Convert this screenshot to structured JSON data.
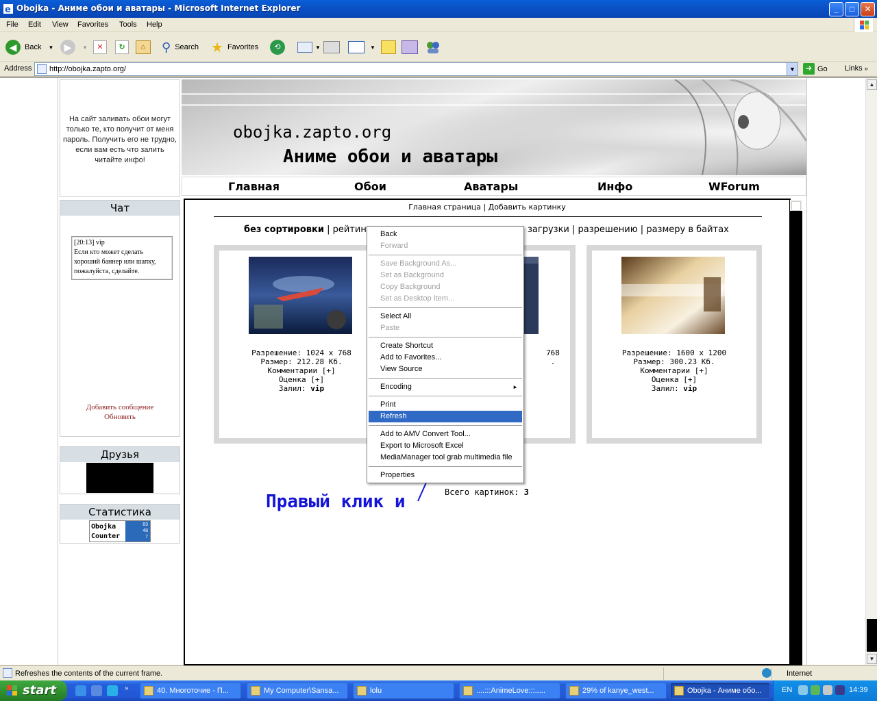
{
  "window": {
    "title": "Obojka - Аниме обои и аватары - Microsoft Internet Explorer",
    "buttons": [
      "_",
      "□",
      "✕"
    ]
  },
  "menu": [
    "File",
    "Edit",
    "View",
    "Favorites",
    "Tools",
    "Help"
  ],
  "toolbar": {
    "back": "Back",
    "search": "Search",
    "favorites": "Favorites"
  },
  "address": {
    "label": "Address",
    "url": "http://obojka.zapto.org/",
    "go": "Go",
    "links": "Links"
  },
  "sidebar": {
    "info_text": "На сайт заливать обои могут только те, кто получит от меня пароль. Получить его не трудно, если вам есть что залить читайте инфо!",
    "chat_title": "Чат",
    "chat_message": {
      "time": "[20:13] vip",
      "text": "Если кто может сделать хороший баннер или шапку, пожалуйста, сделайте."
    },
    "chat_add": "Добавить сообщение",
    "chat_refresh": "Обновить",
    "friends_title": "Друзья",
    "stats_title": "Статистика",
    "counter": {
      "label_1": "Obojka",
      "label_2": "Counter",
      "values": [
        "83",
        "48",
        "7"
      ]
    }
  },
  "banner": {
    "site": "obojka.zapto.org",
    "subtitle": "Аниме обои и аватары"
  },
  "nav": [
    "Главная",
    "Обои",
    "Аватары",
    "Инфо",
    "WForum"
  ],
  "content": {
    "breadcrumbs": "Главная страница | Добавить картинку",
    "sort": {
      "current": "без сортировки",
      "rest": " | рейтин",
      "rest_right": "загрузки | разрешению | размеру в байтах"
    },
    "cards": [
      {
        "resolution": "Разрешение: 1024 x 768",
        "size": "Размер: 212.28 Кб.",
        "comments": "Комментарии [+]",
        "rating": "Оценка [+]",
        "uploaded_label": "Залил: ",
        "uploaded_by": "vip"
      },
      {
        "resolution_tail": "768",
        "size_tail": "."
      },
      {
        "resolution": "Разрешение: 1600 x 1200",
        "size": "Размер: 300.23 Кб.",
        "comments": "Комментарии [+]",
        "rating": "Оценка [+]",
        "uploaded_label": "Залил: ",
        "uploaded_by": "vip"
      }
    ],
    "total_label": "Всего картинок: ",
    "total_value": "3",
    "hint": "Правый клик и"
  },
  "context_menu": [
    {
      "label": "Back",
      "state": "enabled"
    },
    {
      "label": "Forward",
      "state": "disabled"
    },
    {
      "label": "Save Background As...",
      "state": "disabled"
    },
    {
      "label": "Set as Background",
      "state": "disabled"
    },
    {
      "label": "Copy Background",
      "state": "disabled"
    },
    {
      "label": "Set as Desktop Item...",
      "state": "disabled"
    },
    {
      "label": "Select All",
      "state": "enabled"
    },
    {
      "label": "Paste",
      "state": "disabled"
    },
    {
      "label": "Create Shortcut",
      "state": "enabled"
    },
    {
      "label": "Add to Favorites...",
      "state": "enabled"
    },
    {
      "label": "View Source",
      "state": "enabled"
    },
    {
      "label": "Encoding",
      "state": "enabled",
      "submenu": "►"
    },
    {
      "label": "Print",
      "state": "enabled"
    },
    {
      "label": "Refresh",
      "state": "selected"
    },
    {
      "label": "Add to AMV Convert Tool...",
      "state": "enabled"
    },
    {
      "label": "Export to Microsoft Excel",
      "state": "enabled"
    },
    {
      "label": "MediaManager tool grab multimedia file",
      "state": "enabled"
    },
    {
      "label": "Properties",
      "state": "enabled"
    }
  ],
  "status": {
    "text": "Refreshes the contents of the current frame.",
    "zone": "Internet"
  },
  "taskbar": {
    "start": "start",
    "tasks": [
      "40. Многоточие - П...",
      "My Computer\\Sansa...",
      "lolu",
      "....:::AnimeLove:::.....",
      "29% of kanye_west...",
      "Obojka - Аниме обо..."
    ],
    "lang": "EN",
    "clock": "14:39"
  },
  "colors": {
    "selection": "#316ac5",
    "hint_text": "#1414d8",
    "chat_link": "#8b1a1a",
    "titlebar": "#0b52c8"
  }
}
